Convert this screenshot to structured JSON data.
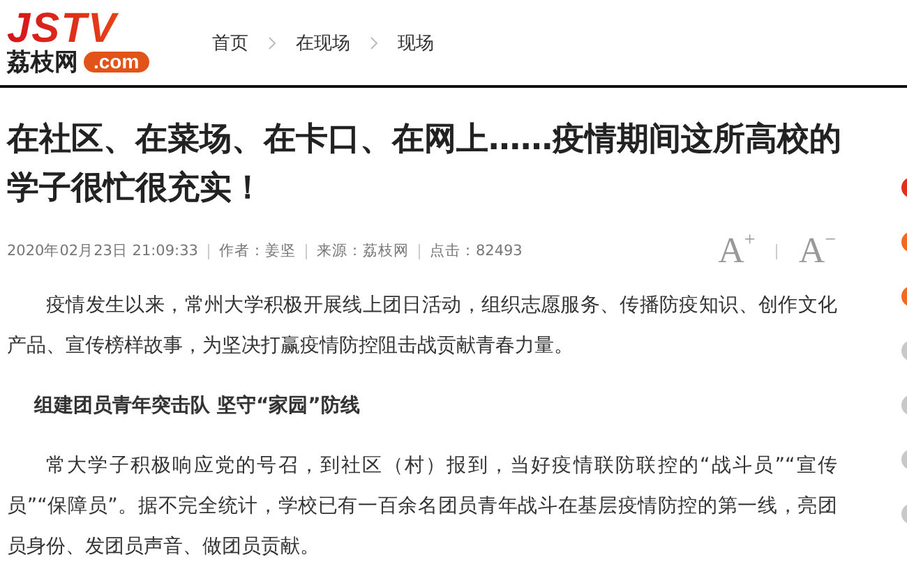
{
  "logo": {
    "mark": "JSTV",
    "name": "荔枝网",
    "domain": ".com"
  },
  "breadcrumb": [
    {
      "label": "首页"
    },
    {
      "label": "在现场"
    },
    {
      "label": "现场"
    }
  ],
  "article": {
    "title": "在社区、在菜场、在卡口、在网上……疫情期间这所高校的学子很忙很充实！",
    "meta": [
      {
        "text": "2020年02月23日 21:09:33"
      },
      {
        "text": "作者：姜坚"
      },
      {
        "text": "来源：荔枝网"
      },
      {
        "text": "点击：82493"
      }
    ],
    "font_buttons": [
      {
        "letter": "A",
        "sign": "+"
      },
      {
        "letter": "A",
        "sign": "−"
      }
    ],
    "blocks": [
      {
        "kind": "paragraph",
        "text": "疫情发生以来，常州大学积极开展线上团日活动，组织志愿服务、传播防疫知识、创作文化产品、宣传榜样故事，为坚决打赢疫情防控阻击战贡献青春力量。"
      },
      {
        "kind": "heading",
        "text": "组建团员青年突击队 坚守“家园”防线"
      },
      {
        "kind": "paragraph",
        "text": "常大学子积极响应党的号召，到社区（村）报到，当好疫情联防联控的“战斗员”“宣传员”“保障员”。据不完全统计，学校已有一百余名团员青年战斗在基层疫情防控的第一线，亮团员身份、发团员声音、做团员贡献。"
      }
    ]
  },
  "sidebar": {
    "rank_dots": [
      {
        "color": "#e0301e"
      },
      {
        "color": "#f26a22"
      },
      {
        "color": "#f26a22"
      },
      {
        "color": "#c8c8c8"
      },
      {
        "color": "#c8c8c8"
      },
      {
        "color": "#c8c8c8"
      },
      {
        "color": "#c8c8c8"
      }
    ]
  }
}
